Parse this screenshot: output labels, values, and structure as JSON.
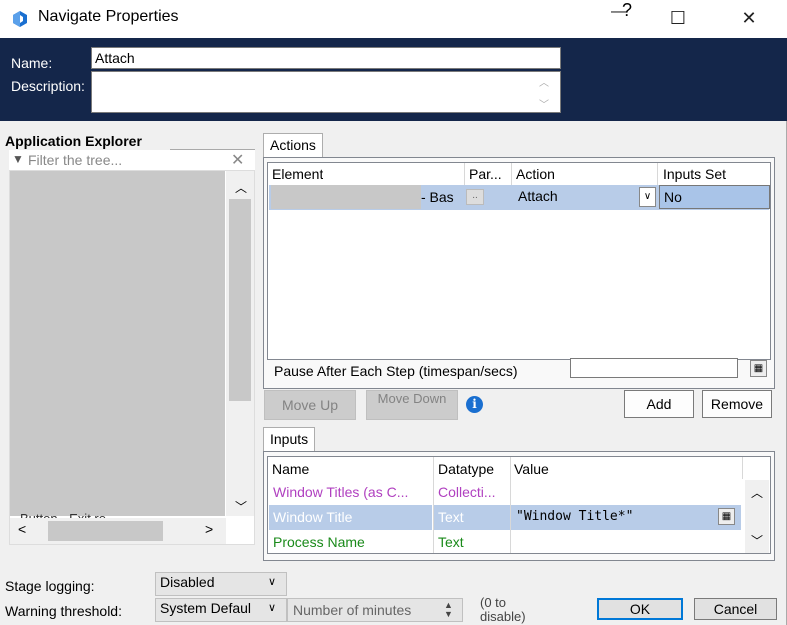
{
  "window": {
    "title": "Navigate Properties",
    "help_glyph": "?",
    "minimize_glyph": "—",
    "maximize_glyph": "☐",
    "close_glyph": "✕"
  },
  "header": {
    "name_label": "Name:",
    "name_value": "Attach",
    "description_label": "Description:",
    "description_value": ""
  },
  "explorer": {
    "title": "Application Explorer",
    "filter_placeholder": "Filter the tree...",
    "partial_item_text": "Button - Exit re..."
  },
  "actions": {
    "tab_label": "Actions",
    "columns": [
      "Element",
      "Par...",
      "Action",
      "Inputs Set"
    ],
    "rows": [
      {
        "element": "- Bas",
        "params": "..",
        "action": "Attach",
        "inputs_set": "No"
      }
    ],
    "pause_label": "Pause After Each Step (timespan/secs)",
    "pause_value": "",
    "move_up_label": "Move Up",
    "move_down_label": "Move Down",
    "add_label": "Add",
    "remove_label": "Remove"
  },
  "inputs": {
    "tab_label": "Inputs",
    "columns": [
      "Name",
      "Datatype",
      "Value"
    ],
    "rows": [
      {
        "name": "Window Titles (as C...",
        "datatype": "Collecti...",
        "value": "",
        "color": "#b040c0"
      },
      {
        "name": "Window Title",
        "datatype": "Text",
        "value": "\"Window Title*\"",
        "color": "#ffffff"
      },
      {
        "name": "Process Name",
        "datatype": "Text",
        "value": "",
        "color": "#1a8a1a"
      }
    ]
  },
  "footer": {
    "stage_logging_label": "Stage logging:",
    "stage_logging_value": "Disabled",
    "warning_label": "Warning threshold:",
    "warning_value": "System Defaul",
    "minutes_placeholder": "Number of minutes",
    "disable_hint": "(0 to disable)",
    "ok_label": "OK",
    "cancel_label": "Cancel"
  },
  "colors": {
    "header_bg": "#14264a",
    "selection": "#b8cce8",
    "accent": "#0078d7"
  }
}
